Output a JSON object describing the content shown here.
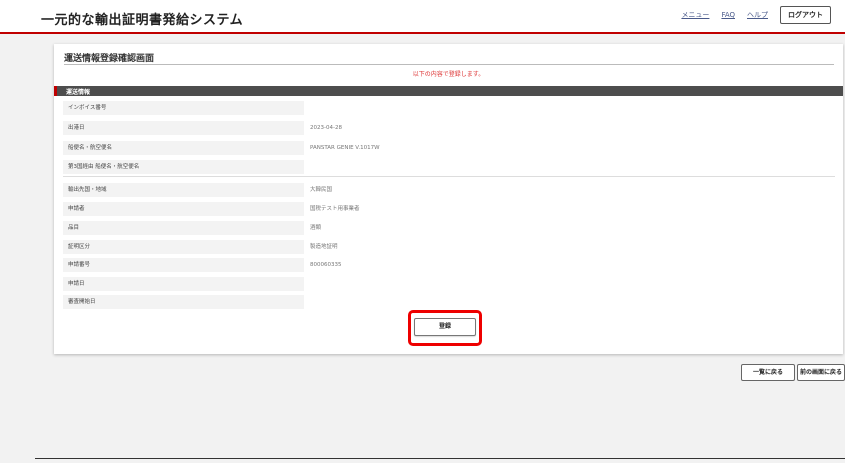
{
  "header": {
    "app_title": "一元的な輸出証明書発給システム",
    "nav": {
      "menu": "メニュー",
      "faq": "FAQ",
      "help": "ヘルプ",
      "logout": "ログアウト"
    }
  },
  "panel": {
    "title": "運送情報登録確認画面",
    "notice": "以下の内容で登録します。",
    "section_label": "運送情報",
    "rows": [
      {
        "label": "インボイス番号",
        "value": ""
      },
      {
        "label": "出港日",
        "value": "2023-04-28"
      },
      {
        "label": "船便名・航空便名",
        "value": "PANSTAR GENIE V.1017W"
      },
      {
        "label": "第3国経由 船便名・航空便名",
        "value": ""
      },
      {
        "label": "輸出先国・地域",
        "value": "大韓民国"
      },
      {
        "label": "申請者",
        "value": "国税テスト用事業者"
      },
      {
        "label": "品目",
        "value": "酒類"
      },
      {
        "label": "証明区分",
        "value": "製造地証明"
      },
      {
        "label": "申請番号",
        "value": "800060335"
      },
      {
        "label": "申請日",
        "value": ""
      },
      {
        "label": "審査開始日",
        "value": ""
      }
    ],
    "register_button": "登録"
  },
  "footer_buttons": {
    "back_to_list": "一覧に戻る",
    "back_to_previous": "前の画面に戻る"
  }
}
